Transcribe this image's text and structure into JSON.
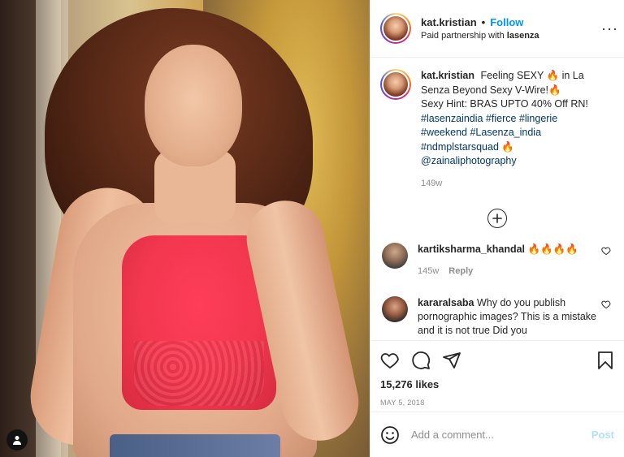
{
  "post": {
    "username": "kat.kristian",
    "dot": "•",
    "follow_label": "Follow",
    "paid_partnership_prefix": "Paid partnership with",
    "partner": "lasenza",
    "more": "···"
  },
  "caption": {
    "username": "kat.kristian",
    "text_1": "Feeling SEXY 🔥 in La Senza Beyond Sexy V-Wire!🔥",
    "text_2": "Sexy Hint: BRAS UPTO 40% Off RN!",
    "hashtags_line1": "#lasenzaindia #fierce #lingerie",
    "hashtags_line2": "#weekend #Lasenza_india",
    "hashtags_line3": "#ndmplstarsquad 🔥",
    "mention": "@zainaliphotography",
    "time": "149w"
  },
  "comments": [
    {
      "username": "kartiksharma_khandal",
      "text": "🔥🔥🔥🔥",
      "time": "145w",
      "reply_label": "Reply"
    },
    {
      "username": "kararalsaba",
      "text": "Why do you publish pornographic images? This is a mistake and it is not true Did you"
    }
  ],
  "likes": "15,276 likes",
  "date": "MAY 5, 2018",
  "add_comment": {
    "placeholder": "Add a comment...",
    "post_label": "Post"
  },
  "colors": {
    "follow": "#0095f6",
    "hashtag": "#00376b",
    "muted": "#8e8e8e",
    "post_disabled": "#b2dffc"
  }
}
